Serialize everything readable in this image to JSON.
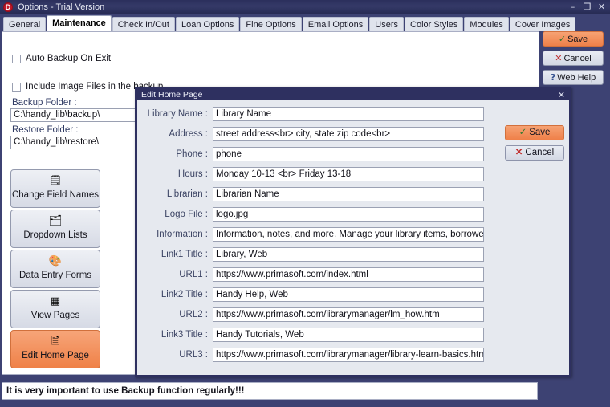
{
  "window": {
    "title": "Options - Trial Version",
    "icon": "app-logo-icon",
    "minimize": "–",
    "maximize": "❐",
    "close": "✕"
  },
  "tabs": [
    {
      "label": "General",
      "active": false
    },
    {
      "label": "Maintenance",
      "active": true
    },
    {
      "label": "Check In/Out",
      "active": false
    },
    {
      "label": "Loan Options",
      "active": false
    },
    {
      "label": "Fine Options",
      "active": false
    },
    {
      "label": "Email Options",
      "active": false
    },
    {
      "label": "Users",
      "active": false
    },
    {
      "label": "Color Styles",
      "active": false
    },
    {
      "label": "Modules",
      "active": false
    },
    {
      "label": "Cover Images",
      "active": false
    }
  ],
  "rail_buttons": [
    {
      "label": "Save",
      "glyph": "✓",
      "glyph_class": "gl-check",
      "primary": true
    },
    {
      "label": "Cancel",
      "glyph": "✕",
      "glyph_class": "gl-x",
      "primary": false
    },
    {
      "label": "Web Help",
      "glyph": "?",
      "glyph_class": "gl-q",
      "primary": false
    }
  ],
  "maintenance": {
    "auto_backup_label": "Auto Backup On Exit",
    "auto_backup_checked": false,
    "include_images_label": "Include Image Files in the backup",
    "include_images_checked": false,
    "backup_folder_label": "Backup Folder :",
    "backup_folder_value": "C:\\handy_lib\\backup\\",
    "restore_folder_label": "Restore Folder :",
    "restore_folder_value": "C:\\handy_lib\\restore\\"
  },
  "side_buttons": [
    {
      "label": "Change Field Names",
      "icon": "edit-fields-icon",
      "glyph": "🗒",
      "primary": false
    },
    {
      "label": "Dropdown Lists",
      "icon": "dropdown-list-icon",
      "glyph": "🗂",
      "primary": false
    },
    {
      "label": "Data Entry Forms",
      "icon": "data-entry-form-icon",
      "glyph": "🎨",
      "primary": false
    },
    {
      "label": "View Pages",
      "icon": "view-pages-icon",
      "glyph": "▦",
      "primary": false
    },
    {
      "label": "Edit Home Page",
      "icon": "page-document-icon",
      "glyph": "🗎",
      "primary": true
    }
  ],
  "status_bar": {
    "message": "It is very important to use Backup function regularly!!!"
  },
  "dialog": {
    "title": "Edit Home Page",
    "close_glyph": "✕",
    "fields": [
      {
        "label": "Library Name :",
        "value": "Library Name"
      },
      {
        "label": "Address :",
        "value": "street address<br> city,  state  zip code<br>"
      },
      {
        "label": "Phone :",
        "value": "phone"
      },
      {
        "label": "Hours :",
        "value": "Monday 10-13 <br> Friday 13-18"
      },
      {
        "label": "Librarian :",
        "value": "Librarian Name"
      },
      {
        "label": "Logo File :",
        "value": "logo.jpg"
      },
      {
        "label": "Information :",
        "value": "Information, notes, and more. Manage your library items, borrower inf"
      },
      {
        "label": "Link1 Title :",
        "value": "Library, Web"
      },
      {
        "label": "URL1 :",
        "value": "https://www.primasoft.com/index.html"
      },
      {
        "label": "Link2 Title :",
        "value": "Handy Help, Web"
      },
      {
        "label": "URL2 :",
        "value": "https://www.primasoft.com/librarymanager/lm_how.htm"
      },
      {
        "label": "Link3 Title :",
        "value": "Handy Tutorials, Web"
      },
      {
        "label": "URL3 :",
        "value": "https://www.primasoft.com/librarymanager/library-learn-basics.htm"
      }
    ],
    "buttons": [
      {
        "label": "Save",
        "glyph": "✓",
        "glyph_class": "gl-check",
        "primary": true
      },
      {
        "label": "Cancel",
        "glyph": "✕",
        "glyph_class": "gl-x",
        "primary": false
      }
    ]
  },
  "colors": {
    "titlebar": "#2b2f5c",
    "window_bg": "#3d4273",
    "dialog_border": "#2e3060",
    "dialog_bg": "#e6e9ef",
    "accent_orange": "#ef8049",
    "content_bg": "#ffffff"
  }
}
